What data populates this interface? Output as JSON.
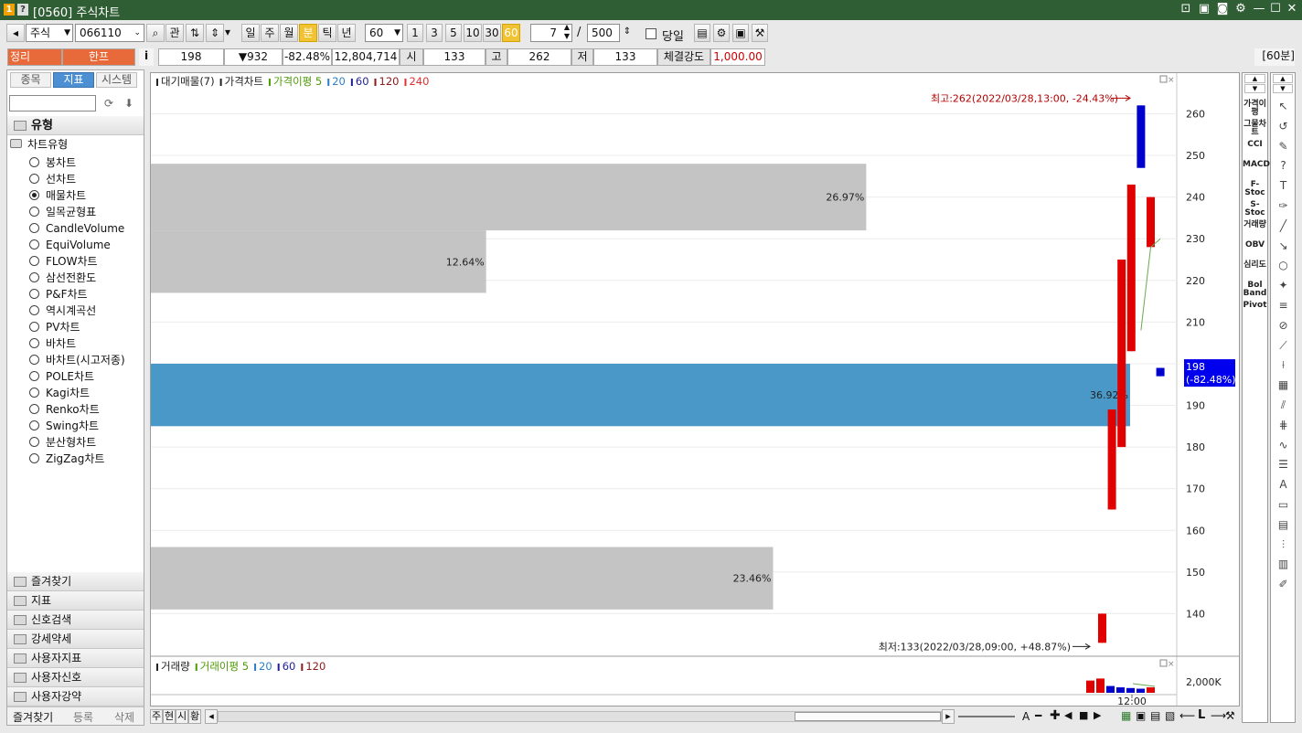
{
  "window": {
    "badges": [
      "1",
      "?"
    ],
    "title": "[0560] 주식차트",
    "controls": [
      "⊡",
      "▣",
      "◙",
      "⚙",
      "—",
      "☐",
      "✕"
    ]
  },
  "toolbar": {
    "market": "주식",
    "code": "066110",
    "btn_kwan": "관",
    "periods": [
      "일",
      "주",
      "월",
      "분",
      "틱",
      "년"
    ],
    "active_period": "분",
    "interval_value": "60",
    "quick_intervals": [
      "1",
      "3",
      "5",
      "10",
      "30",
      "60"
    ],
    "active_interval": "60",
    "count_value": "7",
    "slash": "/",
    "total_value": "500",
    "today_label": "당일"
  },
  "quote": {
    "btn_jungri": "정리",
    "name": "한프",
    "info": "i",
    "price": "198",
    "change": "▼932",
    "change_pct": "-82.48%",
    "volume": "12,804,714",
    "open_label": "시",
    "open": "133",
    "high_label": "고",
    "high": "262",
    "low_label": "저",
    "low": "133",
    "strength_label": "체결강도",
    "strength": "1,000.00",
    "period_tag": "[60분]"
  },
  "left": {
    "tabs": [
      "종목",
      "지표",
      "시스템"
    ],
    "active_tab": "지표",
    "section_title": "유형",
    "tree_root": "차트유형",
    "chart_types": [
      "봉차트",
      "선차트",
      "매물차트",
      "일목균형표",
      "CandleVolume",
      "EquiVolume",
      "FLOW차트",
      "삼선전환도",
      "P&F차트",
      "역시계곡선",
      "PV차트",
      "바차트",
      "바차트(시고저종)",
      "POLE차트",
      "Kagi차트",
      "Renko차트",
      "Swing차트",
      "분산형차트",
      "ZigZag차트"
    ],
    "selected_type": "매물차트",
    "folders": [
      "즐겨찾기",
      "지표",
      "신호검색",
      "강세약세",
      "사용자지표",
      "사용자신호",
      "사용자강약"
    ],
    "bottom_buttons": [
      "즐겨찾기",
      "등록",
      "삭제"
    ]
  },
  "chart_data": [
    {
      "type": "bar",
      "legend": [
        {
          "name": "대기매물(7)",
          "color": "#222222"
        },
        {
          "name": "가격차트",
          "color": "#222222"
        },
        {
          "name": "가격이평 5",
          "color": "#4e9a06"
        },
        {
          "name": "20",
          "color": "#2a7fc8"
        },
        {
          "name": "60",
          "color": "#1f1f9a"
        },
        {
          "name": "120",
          "color": "#8b1a1a"
        },
        {
          "name": "240",
          "color": "#e03030"
        }
      ],
      "ylim": [
        130,
        268
      ],
      "yticks": [
        140,
        150,
        160,
        170,
        180,
        190,
        200,
        210,
        220,
        230,
        240,
        250,
        260
      ],
      "volume_profile": [
        {
          "from": 232,
          "to": 248,
          "pct": 26.97,
          "label": "26.97%",
          "highlight": false
        },
        {
          "from": 217,
          "to": 232,
          "pct": 12.64,
          "label": "12.64%",
          "highlight": false
        },
        {
          "from": 185,
          "to": 200,
          "pct": 36.92,
          "label": "36.92%",
          "highlight": true
        },
        {
          "from": 141,
          "to": 156,
          "pct": 23.46,
          "label": "23.46%",
          "highlight": false
        }
      ],
      "candles": [
        {
          "open": 133,
          "close": 140,
          "high": 140,
          "low": 133,
          "dir": "up"
        },
        {
          "open": 165,
          "close": 189,
          "high": 189,
          "low": 165,
          "dir": "up"
        },
        {
          "open": 180,
          "close": 225,
          "high": 225,
          "low": 180,
          "dir": "up"
        },
        {
          "open": 203,
          "close": 243,
          "high": 243,
          "low": 203,
          "dir": "up"
        },
        {
          "open": 262,
          "close": 247,
          "high": 262,
          "low": 247,
          "dir": "down"
        },
        {
          "open": 228,
          "close": 240,
          "high": 240,
          "low": 228,
          "dir": "up"
        },
        {
          "open": 199,
          "close": 197,
          "high": 199,
          "low": 197,
          "dir": "down"
        }
      ],
      "ma5": [
        null,
        null,
        null,
        null,
        208,
        228,
        230
      ],
      "high_annotation": "최고:262(2022/03/28,13:00, -24.43%)",
      "low_annotation": "최저:133(2022/03/28,09:00, +48.87%)",
      "current_price_label": [
        "198",
        "(-82.48%)"
      ],
      "current_price": 198,
      "up_color": "#e00000",
      "down_color": "#0000cc",
      "profile_color": "#c4c4c4",
      "profile_highlight_color": "#4a98c8"
    },
    {
      "type": "bar",
      "legend": [
        {
          "name": "거래량",
          "color": "#222222"
        },
        {
          "name": "거래이평 5",
          "color": "#4e9a06"
        },
        {
          "name": "20",
          "color": "#2a7fc8"
        },
        {
          "name": "60",
          "color": "#1f1f9a"
        },
        {
          "name": "120",
          "color": "#8b1a1a"
        }
      ],
      "ylim": [
        0,
        3500
      ],
      "yticks": [
        2000
      ],
      "ytick_labels": [
        "2,000K"
      ],
      "xtick_label": "12:00",
      "bars": [
        {
          "value": 1800,
          "dir": "up"
        },
        {
          "value": 2100,
          "dir": "up"
        },
        {
          "value": 1000,
          "dir": "down"
        },
        {
          "value": 800,
          "dir": "down"
        },
        {
          "value": 700,
          "dir": "down"
        },
        {
          "value": 600,
          "dir": "down"
        },
        {
          "value": 800,
          "dir": "up"
        }
      ]
    }
  ],
  "indicators": [
    "가격이평",
    "그물차트",
    "CCI",
    "MACD",
    "F-Stoc",
    "S-Stoc",
    "거래량",
    "OBV",
    "심리도",
    "Bol Band",
    "Pivot"
  ],
  "tools": [
    "cursor-icon",
    "undo-icon",
    "eraser-icon",
    "help-icon",
    "text-icon",
    "pen-icon",
    "line-icon",
    "arrow-line-icon",
    "circle-icon",
    "mark-icon",
    "hline-icon",
    "fib-icon",
    "trend-icon",
    "fan-icon",
    "grid-icon",
    "parallel-icon",
    "channel-icon",
    "wave-icon",
    "list-icon",
    "auto-icon",
    "window-icon",
    "doc-icon",
    "stat-icon",
    "chart-icon",
    "wrench-icon"
  ],
  "bottom": {
    "left_buttons": [
      "주",
      "현",
      "시",
      "황"
    ],
    "arrow_left": "◂",
    "arrow_right": "▸",
    "zoom_label": "A"
  }
}
